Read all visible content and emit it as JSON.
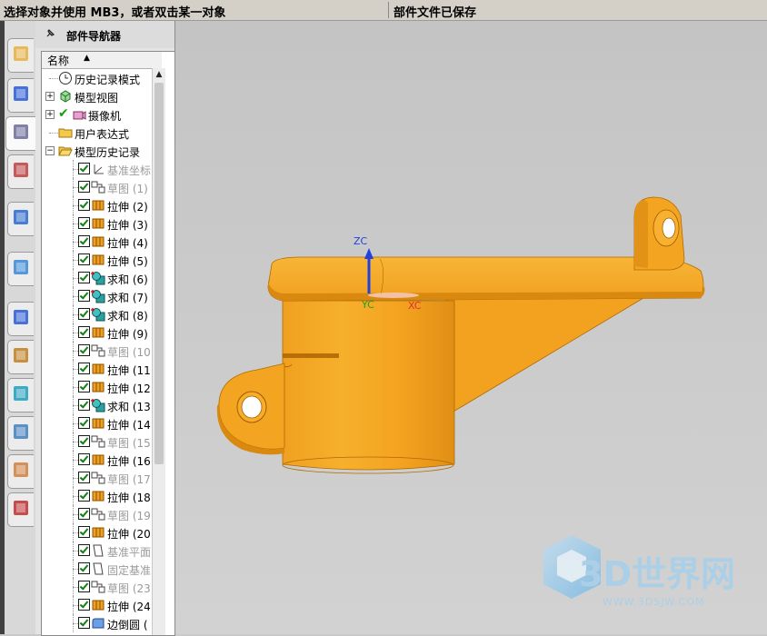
{
  "status": {
    "prompt": "选择对象并使用 MB3，或者双击某一对象",
    "message": "部件文件已保存"
  },
  "resource_bar": {
    "tabs": [
      {
        "icon": "assembly-navigator-icon"
      },
      {
        "icon": "constraint-navigator-icon"
      },
      {
        "icon": "part-navigator-icon"
      },
      {
        "icon": "reuse-library-icon"
      },
      {
        "icon": "internet-explorer-icon"
      },
      {
        "icon": "process-studio-icon"
      },
      {
        "icon": "history-icon"
      },
      {
        "icon": "system-materials-icon"
      },
      {
        "icon": "visualization-icon"
      },
      {
        "icon": "process-navigator-icon"
      },
      {
        "icon": "roles-icon"
      },
      {
        "icon": "system-scene-icon"
      }
    ]
  },
  "navigator": {
    "title": "部件导航器",
    "column_header": "名称",
    "top_items": [
      {
        "label": "历史记录模式",
        "icon": "clock-icon",
        "expander": ""
      },
      {
        "label": "模型视图",
        "icon": "model-view-icon",
        "expander": "+"
      },
      {
        "label": "摄像机",
        "icon": "camera-icon",
        "expander": "+"
      },
      {
        "label": "用户表达式",
        "icon": "folder-icon",
        "expander": ""
      },
      {
        "label": "模型历史记录",
        "icon": "open-folder-icon",
        "expander": "−"
      }
    ],
    "features": [
      {
        "label": "基准坐标",
        "icon": "datum-csys-icon",
        "dim": true
      },
      {
        "label": "草图 (1)",
        "icon": "sketch-icon",
        "dim": true
      },
      {
        "label": "拉伸 (2)",
        "icon": "extrude-icon",
        "dim": false
      },
      {
        "label": "拉伸 (3)",
        "icon": "extrude-icon",
        "dim": false
      },
      {
        "label": "拉伸 (4)",
        "icon": "extrude-icon",
        "dim": false
      },
      {
        "label": "拉伸 (5)",
        "icon": "extrude-icon",
        "dim": false
      },
      {
        "label": "求和 (6)",
        "icon": "unite-icon",
        "dim": false
      },
      {
        "label": "求和 (7)",
        "icon": "unite-icon",
        "dim": false
      },
      {
        "label": "求和 (8)",
        "icon": "unite-icon",
        "dim": false
      },
      {
        "label": "拉伸 (9)",
        "icon": "extrude-icon",
        "dim": false
      },
      {
        "label": "草图 (10",
        "icon": "sketch-icon",
        "dim": true
      },
      {
        "label": "拉伸 (11",
        "icon": "extrude-icon",
        "dim": false
      },
      {
        "label": "拉伸 (12",
        "icon": "extrude-icon",
        "dim": false
      },
      {
        "label": "求和 (13",
        "icon": "unite-icon",
        "dim": false
      },
      {
        "label": "拉伸 (14",
        "icon": "extrude-icon",
        "dim": false
      },
      {
        "label": "草图 (15",
        "icon": "sketch-icon",
        "dim": true
      },
      {
        "label": "拉伸 (16",
        "icon": "extrude-icon",
        "dim": false
      },
      {
        "label": "草图 (17",
        "icon": "sketch-icon",
        "dim": true
      },
      {
        "label": "拉伸 (18",
        "icon": "extrude-icon",
        "dim": false
      },
      {
        "label": "草图 (19",
        "icon": "sketch-icon",
        "dim": true
      },
      {
        "label": "拉伸 (20",
        "icon": "extrude-icon",
        "dim": false
      },
      {
        "label": "基准平面",
        "icon": "datum-plane-icon",
        "dim": true
      },
      {
        "label": "固定基准",
        "icon": "datum-plane-icon",
        "dim": true
      },
      {
        "label": "草图 (23",
        "icon": "sketch-icon",
        "dim": true
      },
      {
        "label": "拉伸 (24",
        "icon": "extrude-icon",
        "dim": false
      },
      {
        "label": "边倒圆 (",
        "icon": "edge-blend-icon",
        "dim": false
      }
    ]
  },
  "viewport": {
    "axis_labels": {
      "zc": "ZC",
      "yc": "YC",
      "xc": "XC"
    },
    "colors": {
      "part": "#f5a623",
      "zc_axis": "#2040e0",
      "yc_axis": "#20a020",
      "xc_axis": "#e03030"
    },
    "watermark": {
      "brand": "3D世界网",
      "url": "WWW.3DSJW.COM"
    }
  }
}
